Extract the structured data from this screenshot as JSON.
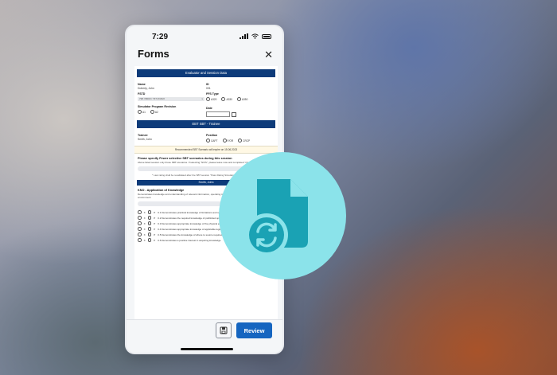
{
  "status_bar": {
    "time": "7:29"
  },
  "header": {
    "title": "Forms",
    "close_glyph": "✕"
  },
  "form": {
    "section1": {
      "title": "Evaluator and Session Data",
      "name_label": "Name",
      "name_value": "Doherty, John",
      "id_label": "ID",
      "id_value": "001",
      "ftd_label": "FSTD",
      "ftd_value": "738 / B003 / 737-8 MAX",
      "ftd_type_label": "FFS Type",
      "ftd_type_options": [
        "A320",
        "A330",
        "A350"
      ],
      "sim_label": "Simulator Program Revision",
      "sim_options": [
        "A1",
        "A2"
      ],
      "date_label": "Date"
    },
    "section2": {
      "title": "EBT SBT - Trainee",
      "trainee_label": "Trainee",
      "trainee_value": "Smith, John",
      "position_label": "Position",
      "position_options": [
        "CAPT",
        "F/OR",
        "CRCP"
      ],
      "recommendation": "Recommended SBT Scenario will expire on 15.06.2023",
      "question_title": "Please specify Fewer selective SBT scenarios during this session",
      "question_text": "Above listed session only those SBT scenarios. If selecting \"N/FS\", please leave note and completed \"checklist and not the form",
      "note": "* Last rating shall be revalidated after the SBT session\n\"Pass Rating Simulation Check Result\" entered",
      "band": "Smith, John"
    },
    "section3": {
      "title": "KNO - Application of Knowledge",
      "text": "Demonstrates knowledge and understanding of relevant information, operating instructions, aircraft systems and the operating environment",
      "items": [
        "0.1 Demonstrates practical knowledge of limitations and systems",
        "0.2 Demonstrates the required knowledge of published operating instructions",
        "0.3 Demonstrates appropriate knowledge of the physical environment",
        "0.4 Demonstrates appropriate knowledge of applicable legislation",
        "0.5 Demonstrates the knowledge of where to source required information",
        "0.6 Demonstrates a positive interest in acquiring knowledge"
      ],
      "options": [
        "X",
        "P"
      ]
    }
  },
  "footer": {
    "review_label": "Review"
  },
  "colors": {
    "primary_button": "#1565c0",
    "band": "#0d3b7a",
    "accent_circle": "#8be3ea",
    "icon": "#1aa2b4"
  },
  "icons": {
    "overlay": "form-sync-icon",
    "save": "save-icon"
  }
}
